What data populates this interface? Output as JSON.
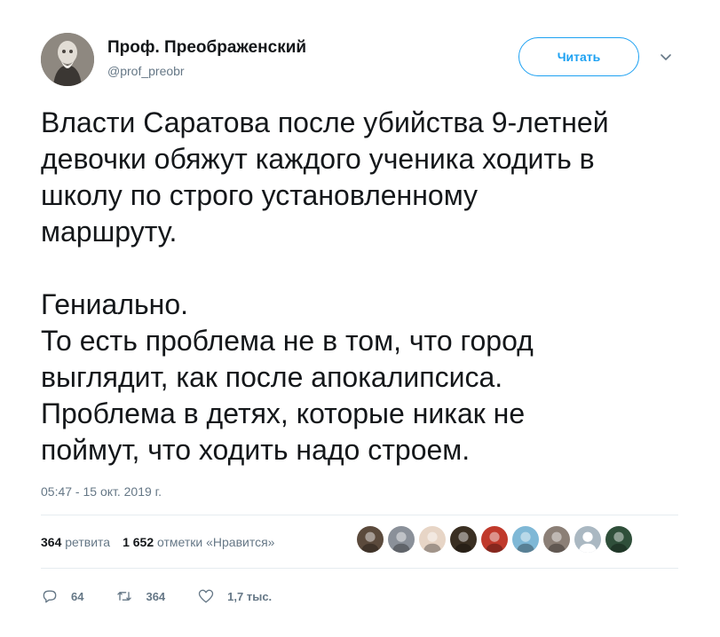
{
  "author": {
    "name": "Проф. Преображенский",
    "handle": "@prof_preobr"
  },
  "follow_label": "Читать",
  "tweet_text": "Власти Саратова после убийства 9-летней\nдевочки обяжут каждого ученика ходить в\nшколу по строго установленному\nмаршруту.\n\nГениально.\nТо есть проблема не в том, что город\nвыглядит, как после апокалипсиса.\nПроблема в детях, которые никак не\nпоймут, что ходить надо строем.",
  "timestamp": "05:47 - 15 окт. 2019 г.",
  "stats": {
    "retweets_count": "364",
    "retweets_label": "ретвита",
    "likes_count": "1 652",
    "likes_label": "отметки «Нравится»"
  },
  "likers": [
    {
      "icon": "avatar-icon",
      "color": "#5b4a3c"
    },
    {
      "icon": "avatar-icon",
      "color": "#8a9099"
    },
    {
      "icon": "avatar-icon",
      "color": "#e7d5c6"
    },
    {
      "icon": "avatar-icon",
      "color": "#3a2f22"
    },
    {
      "icon": "avatar-icon",
      "color": "#c0392b"
    },
    {
      "icon": "avatar-icon",
      "color": "#7fb8d6"
    },
    {
      "icon": "avatar-icon",
      "color": "#8b7f76"
    },
    {
      "icon": "default-avatar-icon",
      "color": "#aab8c2"
    },
    {
      "icon": "avatar-icon",
      "color": "#2f4f3a"
    }
  ],
  "actions": {
    "reply_count": "64",
    "retweet_count": "364",
    "like_count": "1,7 тыс."
  },
  "colors": {
    "accent": "#1da1f2",
    "secondary_text": "#657786",
    "divider": "#e6ecf0"
  }
}
